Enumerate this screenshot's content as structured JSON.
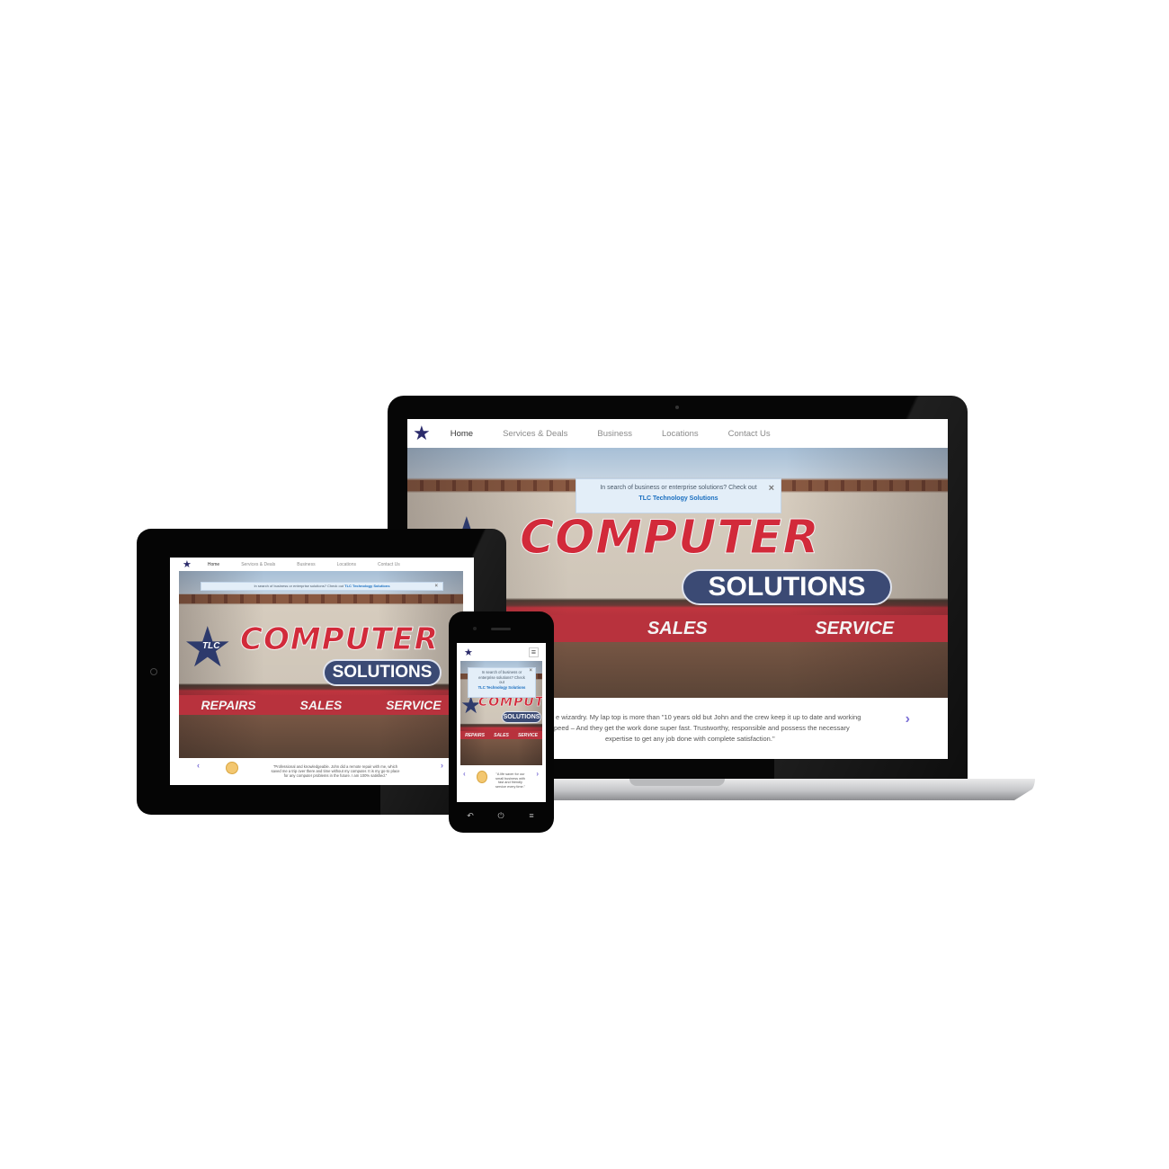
{
  "nav": {
    "items": [
      "Home",
      "Services & Deals",
      "Business",
      "Locations",
      "Contact Us"
    ],
    "logo_icon": "star-logo-icon",
    "menu_icon": "hamburger-menu-icon"
  },
  "alert": {
    "text": "In search of business or enterprise solutions? Check out",
    "link": "TLC Technology Solutions",
    "close": "×",
    "phone_text": "In search of business or enterprise solutions? Check out",
    "tablet_text": "In search of business or enterprise solutions? Check out"
  },
  "hero": {
    "sign_computer": "COMPUTER",
    "sign_solutions": "SOLUTIONS",
    "banner": [
      "REPAIRS",
      "SALES",
      "SERVICE"
    ],
    "logo_text": "TLC"
  },
  "testimonial": {
    "laptop_line1": "e wizardry. My lap top is more than \"10 years old but John and the crew keep it up to date and working",
    "laptop_line2": "peed – And they get the work done super fast. Trustworthy, responsible and possess the necessary",
    "laptop_line3": "expertise to get any job done with complete satisfaction.\"",
    "tablet_line1": "\"Professional and knowledgeable. John did a remote repair with me, which",
    "tablet_line2": "saved me a trip over there and time without my computer. It is my go-to place",
    "tablet_line3": "for any computer problems in the future. I am 100% satisfied.\"",
    "phone_line1": "\"A life saver for our",
    "phone_line2": "small business with",
    "phone_line3": "fast and friendly",
    "phone_line4": "service every time.\"",
    "prev": "‹",
    "next": "›"
  },
  "phone_keys": [
    "↶",
    "⏻",
    "≡"
  ],
  "colors": {
    "accent": "#1a6fc0",
    "nav_star": "#2b2b6b",
    "sign_red": "#d22a3a",
    "alert_bg": "#e3eef8",
    "arrow": "#7b6fd6"
  }
}
